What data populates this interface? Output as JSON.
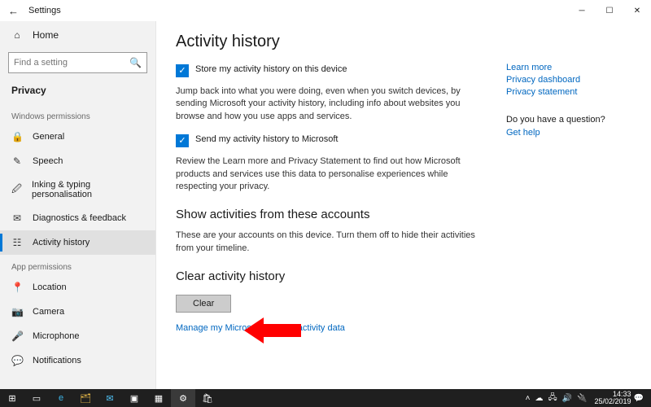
{
  "title": "Settings",
  "home": "Home",
  "search_placeholder": "Find a setting",
  "category": "Privacy",
  "groups": {
    "win": "Windows permissions",
    "app": "App permissions"
  },
  "nav_win": [
    {
      "label": "General",
      "icon": "🔒"
    },
    {
      "label": "Speech",
      "icon": "✎"
    },
    {
      "label": "Inking & typing personalisation",
      "icon": "🖉"
    },
    {
      "label": "Diagnostics & feedback",
      "icon": "✉"
    },
    {
      "label": "Activity history",
      "icon": "☷"
    }
  ],
  "nav_app": [
    {
      "label": "Location",
      "icon": "📍"
    },
    {
      "label": "Camera",
      "icon": "📷"
    },
    {
      "label": "Microphone",
      "icon": "🎤"
    },
    {
      "label": "Notifications",
      "icon": "💬"
    }
  ],
  "page": {
    "h1": "Activity history",
    "chk1": "Store my activity history on this device",
    "desc1": "Jump back into what you were doing, even when you switch devices, by sending Microsoft your activity history, including info about websites you browse and how you use apps and services.",
    "chk2": "Send my activity history to Microsoft",
    "desc2": "Review the Learn more and Privacy Statement to find out how Microsoft products and services use this data to personalise experiences while respecting your privacy.",
    "h2a": "Show activities from these accounts",
    "desc3": "These are your accounts on this device. Turn them off to hide their activities from your timeline.",
    "h2b": "Clear activity history",
    "clear_btn": "Clear",
    "manage_link": "Manage my Microsoft account activity data"
  },
  "help": {
    "learn": "Learn more",
    "dash": "Privacy dashboard",
    "stmt": "Privacy statement",
    "q": "Do you have a question?",
    "get": "Get help"
  },
  "clock": {
    "time": "14:33",
    "date": "25/02/2019"
  }
}
